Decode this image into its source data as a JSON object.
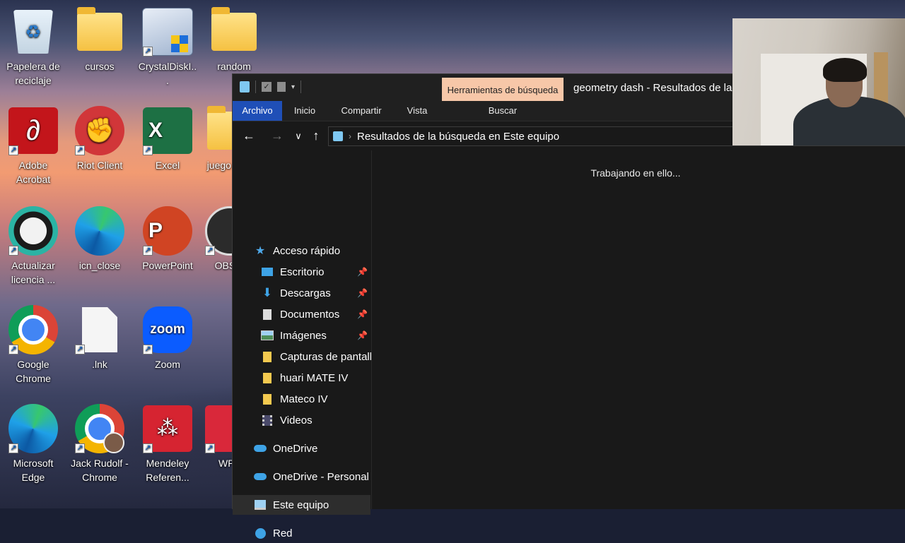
{
  "desktop": {
    "icons": [
      {
        "label": "Papelera de reciclaje",
        "icon": "recycle-bin-icon"
      },
      {
        "label": "cursos",
        "icon": "folder-icon"
      },
      {
        "label": "CrystalDiskI...",
        "icon": "crystaldiskinfo-icon"
      },
      {
        "label": "random",
        "icon": "folder-icon"
      },
      {
        "label": "Adobe Acrobat",
        "icon": "adobe-acrobat-icon"
      },
      {
        "label": "Riot Client",
        "icon": "riot-client-icon"
      },
      {
        "label": "Excel",
        "icon": "excel-icon"
      },
      {
        "label": "juego no c",
        "icon": "folder-icon"
      },
      {
        "label": "Actualizar licencia ...",
        "icon": "app-icon"
      },
      {
        "label": "icn_close",
        "icon": "edge-icon"
      },
      {
        "label": "PowerPoint",
        "icon": "powerpoint-icon"
      },
      {
        "label": "OBS S",
        "icon": "obs-icon"
      },
      {
        "label": "Google Chrome",
        "icon": "chrome-icon"
      },
      {
        "label": ".lnk",
        "icon": "file-icon"
      },
      {
        "label": "Zoom",
        "icon": "zoom-icon"
      },
      {
        "label": "Microsoft Edge",
        "icon": "edge-icon"
      },
      {
        "label": "Jack Rudolf - Chrome",
        "icon": "chrome-profile-icon"
      },
      {
        "label": "Mendeley Referen...",
        "icon": "mendeley-icon"
      },
      {
        "label": "WPS",
        "icon": "wps-icon"
      }
    ]
  },
  "explorer": {
    "context_tab": "Herramientas de búsqueda",
    "title": "geometry dash - Resultados de la",
    "ribbon_tabs": [
      "Archivo",
      "Inicio",
      "Compartir",
      "Vista"
    ],
    "context_ribbon_tab": "Buscar",
    "address": "Resultados de la búsqueda en Este equipo",
    "status_message": "Trabajando en ello...",
    "nav": [
      {
        "label": "Acceso rápido",
        "icon": "star-icon",
        "pinned": false
      },
      {
        "label": "Escritorio",
        "icon": "desktop-folder-icon",
        "pinned": true
      },
      {
        "label": "Descargas",
        "icon": "download-icon",
        "pinned": true
      },
      {
        "label": "Documentos",
        "icon": "documents-icon",
        "pinned": true
      },
      {
        "label": "Imágenes",
        "icon": "pictures-icon",
        "pinned": true
      },
      {
        "label": "Capturas de pantall",
        "icon": "folder-icon",
        "pinned": false
      },
      {
        "label": "huari MATE IV",
        "icon": "folder-icon",
        "pinned": false
      },
      {
        "label": "Mateco IV",
        "icon": "folder-icon",
        "pinned": false
      },
      {
        "label": "Videos",
        "icon": "videos-icon",
        "pinned": false
      },
      {
        "label": "OneDrive",
        "icon": "onedrive-icon",
        "pinned": false
      },
      {
        "label": "OneDrive - Personal",
        "icon": "onedrive-icon",
        "pinned": false
      },
      {
        "label": "Este equipo",
        "icon": "this-pc-icon",
        "pinned": false,
        "selected": true
      },
      {
        "label": "Red",
        "icon": "network-icon",
        "pinned": false
      }
    ]
  },
  "colors": {
    "explorer_bg": "#191919",
    "file_tab": "#1f4fb7",
    "context_tab": "#f7c7a8"
  }
}
